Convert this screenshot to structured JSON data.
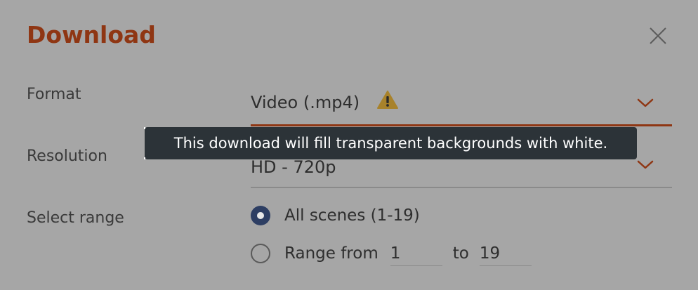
{
  "dialog": {
    "title": "Download",
    "close_icon": "close-icon"
  },
  "format": {
    "label": "Format",
    "value": "Video (.mp4)",
    "warning_icon": "warning-icon",
    "chevron_icon": "chevron-down-icon"
  },
  "tooltip": {
    "text": "This download will fill transparent backgrounds with white."
  },
  "resolution": {
    "label": "Resolution",
    "value": "HD - 720p",
    "chevron_icon": "chevron-down-icon"
  },
  "range": {
    "label": "Select range",
    "all_scenes_label": "All scenes (1-19)",
    "all_scenes_selected": true,
    "range_from_label": "Range from",
    "from_value": "1",
    "to_label": "to",
    "to_value": "19"
  },
  "colors": {
    "accent": "#8f3613",
    "radio_selected": "#2d3e63",
    "tooltip_bg": "#2c3338",
    "warning": "#a8822b",
    "overlay_bg": "#a6a6a6"
  }
}
